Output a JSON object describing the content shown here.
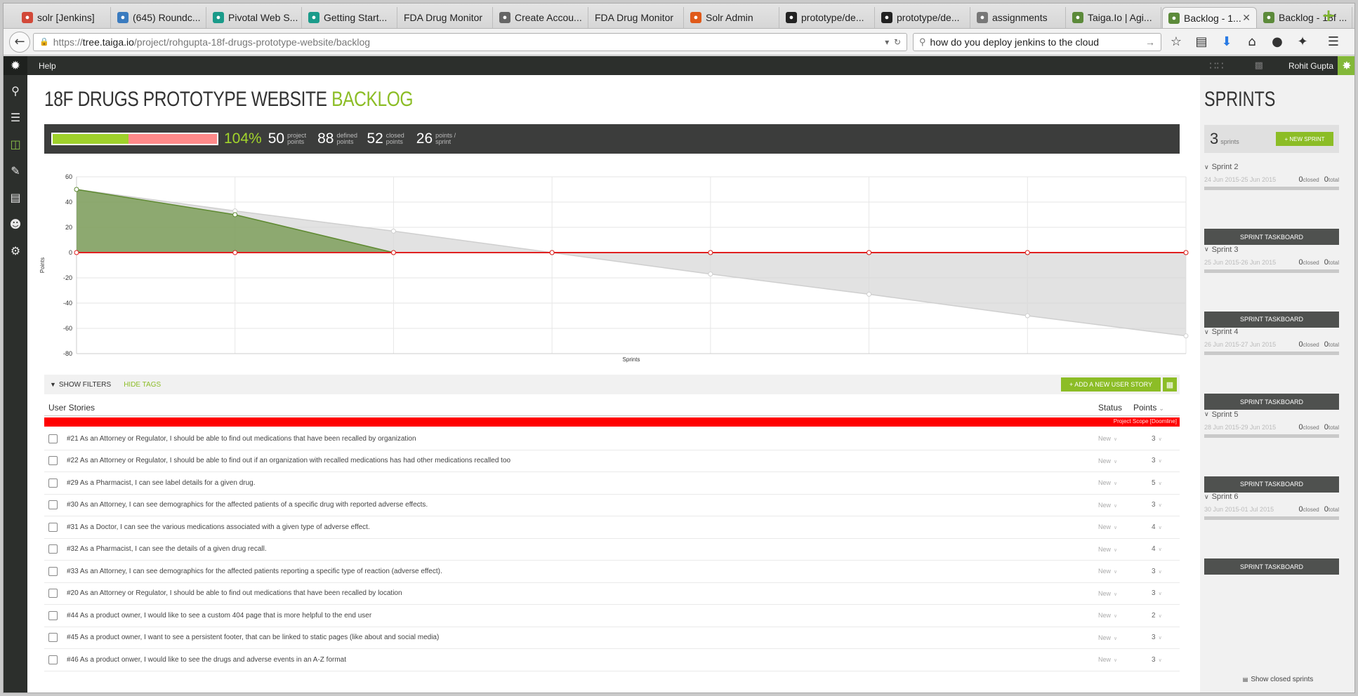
{
  "browser": {
    "tabs": [
      {
        "label": "solr [Jenkins]",
        "icon": "jenkins-icon",
        "color": "#d24939"
      },
      {
        "label": "(645) Roundc...",
        "icon": "roundcube-icon",
        "color": "#3a7bbf"
      },
      {
        "label": "Pivotal Web S...",
        "icon": "pivotal-icon",
        "color": "#1a9b8a"
      },
      {
        "label": "Getting Start...",
        "icon": "pivotal-icon",
        "color": "#1a9b8a"
      },
      {
        "label": "FDA Drug Monitor",
        "icon": "",
        "color": ""
      },
      {
        "label": "Create Accou...",
        "icon": "triangle-icon",
        "color": "#666"
      },
      {
        "label": "FDA Drug Monitor",
        "icon": "",
        "color": ""
      },
      {
        "label": "Solr Admin",
        "icon": "solr-icon",
        "color": "#e05a1a"
      },
      {
        "label": "prototype/de...",
        "icon": "github-icon",
        "color": "#222"
      },
      {
        "label": "prototype/de...",
        "icon": "github-icon",
        "color": "#222"
      },
      {
        "label": "assignments",
        "icon": "person-icon",
        "color": "#777"
      },
      {
        "label": "Taiga.Io | Agi...",
        "icon": "taiga-icon",
        "color": "#5c8a3a"
      },
      {
        "label": "Backlog - 1...",
        "icon": "taiga-icon",
        "color": "#5c8a3a",
        "active": true
      },
      {
        "label": "Backlog - 18f ...",
        "icon": "taiga-icon",
        "color": "#5c8a3a"
      }
    ],
    "url_proto": "https://",
    "url_host": "tree.taiga.io",
    "url_path": "/project/rohgupta-18f-drugs-prototype-website/backlog",
    "search_value": "how do you deploy jenkins to the cloud"
  },
  "header": {
    "help": "Help",
    "user": "Rohit Gupta"
  },
  "page": {
    "title_main": "18F DRUGS PROTOTYPE WEBSITE",
    "title_accent": "BACKLOG"
  },
  "summary": {
    "progress_percent": 104,
    "progress_label": "104%",
    "stats": [
      {
        "num": "50",
        "label": "project points"
      },
      {
        "num": "88",
        "label": "defined points"
      },
      {
        "num": "52",
        "label": "closed points"
      },
      {
        "num": "26",
        "label": "points / sprint"
      }
    ]
  },
  "chart_data": {
    "type": "area",
    "ylabel": "Points",
    "xlabel": "Sprints",
    "ylim": [
      -80,
      60
    ],
    "yticks": [
      60,
      40,
      20,
      0,
      -20,
      -40,
      -60,
      -80
    ],
    "x": [
      0,
      1,
      2,
      3,
      4,
      5,
      6,
      7
    ],
    "series": [
      {
        "values": [
          50,
          33,
          17,
          0,
          -17,
          -33,
          -50,
          -66
        ],
        "color": "#d6d6d6"
      },
      {
        "values": [
          50,
          30,
          0,
          0,
          0,
          0,
          0,
          0
        ],
        "color": "#5f8a32"
      },
      {
        "values": [
          0,
          0,
          0,
          0,
          0,
          0,
          0,
          0
        ],
        "color": "#e02020"
      }
    ]
  },
  "filters": {
    "show_filters": "Show filters",
    "hide_tags": "Hide tags",
    "add_story": "+ Add a new user story"
  },
  "table": {
    "col_stories": "User Stories",
    "col_status": "Status",
    "col_points": "Points",
    "doomline": "Project Scope [Doomline]",
    "stories": [
      {
        "title": "#21 As an Attorney or Regulator, I should be able to find out medications that have been recalled by organization",
        "status": "New",
        "points": "3"
      },
      {
        "title": "#22 As an Attorney or Regulator, I should be able to find out if an organization with recalled medications has had other medications recalled too",
        "status": "New",
        "points": "3"
      },
      {
        "title": "#29 As a Pharmacist, I can see label details for a given drug.",
        "status": "New",
        "points": "5"
      },
      {
        "title": "#30 As an Attorney, I can see demographics for the affected patients of a specific drug with reported adverse effects.",
        "status": "New",
        "points": "3"
      },
      {
        "title": "#31 As a Doctor, I can see the various medications associated with a given type of adverse effect.",
        "status": "New",
        "points": "4"
      },
      {
        "title": "#32 As a Pharmacist, I can see the details of a given drug recall.",
        "status": "New",
        "points": "4"
      },
      {
        "title": "#33 As an Attorney, I can see demographics for the affected patients reporting a specific type of reaction (adverse effect).",
        "status": "New",
        "points": "3"
      },
      {
        "title": "#20 As an Attorney or Regulator, I should be able to find out medications that have been recalled by location",
        "status": "New",
        "points": "3"
      },
      {
        "title": "#44 As a product owner, I would like to see a custom 404 page that is more helpful to the end user",
        "status": "New",
        "points": "2"
      },
      {
        "title": "#45 As a product owner, I want to see a persistent footer, that can be linked to static pages (like about and social media)",
        "status": "New",
        "points": "3"
      },
      {
        "title": "#46 As a product onwer, I would like to see the drugs and adverse events in an A-Z format",
        "status": "New",
        "points": "3"
      }
    ]
  },
  "sprints": {
    "title": "SPRINTS",
    "count": "3",
    "count_label": "sprints",
    "new_sprint": "+ New sprint",
    "closed_label": "closed",
    "total_label": "total",
    "taskboard": "Sprint Taskboard",
    "show_closed": "Show closed sprints",
    "items": [
      {
        "name": "Sprint 2",
        "dates": "24 Jun 2015-25 Jun 2015",
        "closed": "0",
        "total": "0"
      },
      {
        "name": "Sprint 3",
        "dates": "25 Jun 2015-26 Jun 2015",
        "closed": "0",
        "total": "0"
      },
      {
        "name": "Sprint 4",
        "dates": "26 Jun 2015-27 Jun 2015",
        "closed": "0",
        "total": "0"
      },
      {
        "name": "Sprint 5",
        "dates": "28 Jun 2015-29 Jun 2015",
        "closed": "0",
        "total": "0"
      },
      {
        "name": "Sprint 6",
        "dates": "30 Jun 2015-01 Jul 2015",
        "closed": "0",
        "total": "0"
      }
    ]
  }
}
